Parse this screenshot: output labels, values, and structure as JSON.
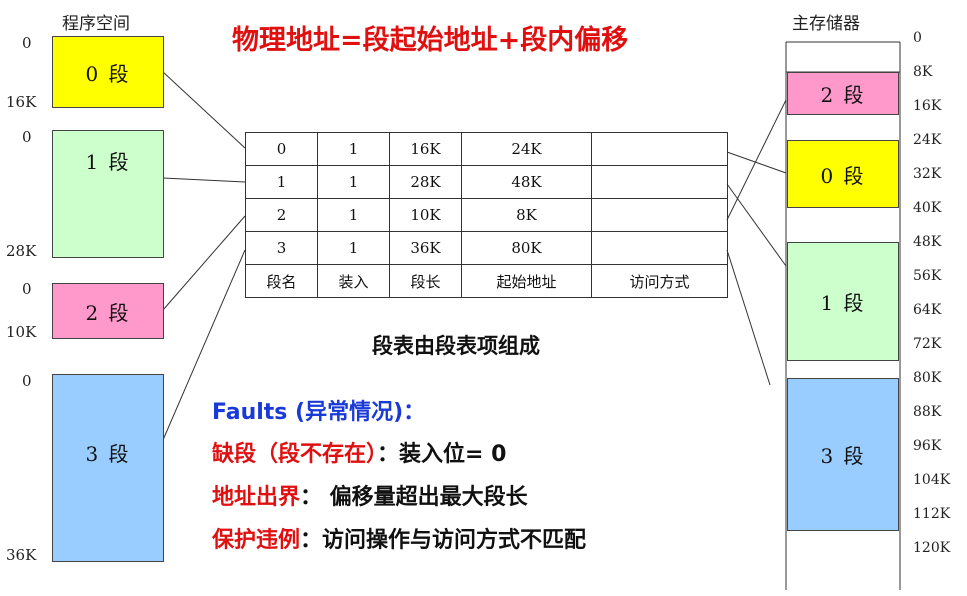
{
  "title": "物理地址=段起始地址+段内偏移",
  "program_space": {
    "label": "程序空间",
    "segments": [
      {
        "name": "0 段",
        "start": "0",
        "end": "16K",
        "color": "#ffff00"
      },
      {
        "name": "1 段",
        "start": "0",
        "end": "28K",
        "color": "#ccffcc"
      },
      {
        "name": "2 段",
        "start": "0",
        "end": "10K",
        "color": "#ff99cc"
      },
      {
        "name": "3 段",
        "start": "0",
        "end": "36K",
        "color": "#99ccff"
      }
    ]
  },
  "main_memory": {
    "label": "主存储器",
    "ticks": [
      "0",
      "8K",
      "16K",
      "24K",
      "32K",
      "40K",
      "48K",
      "56K",
      "64K",
      "72K",
      "80K",
      "88K",
      "96K",
      "104K",
      "112K",
      "120K"
    ],
    "segments": [
      {
        "name": "2 段",
        "from_k": 8,
        "to_k": 18,
        "color": "#ff99cc"
      },
      {
        "name": "0 段",
        "from_k": 24,
        "to_k": 40,
        "color": "#ffff00"
      },
      {
        "name": "1 段",
        "from_k": 48,
        "to_k": 76,
        "color": "#ccffcc"
      },
      {
        "name": "3 段",
        "from_k": 80,
        "to_k": 116,
        "color": "#99ccff"
      }
    ]
  },
  "segment_table": {
    "rows": [
      [
        "0",
        "1",
        "16K",
        "24K",
        ""
      ],
      [
        "1",
        "1",
        "28K",
        "48K",
        ""
      ],
      [
        "2",
        "1",
        "10K",
        "8K",
        ""
      ],
      [
        "3",
        "1",
        "36K",
        "80K",
        ""
      ]
    ],
    "headers": [
      "段名",
      "装入",
      "段长",
      "起始地址",
      "访问方式"
    ]
  },
  "caption": "段表由段表项组成",
  "faults": {
    "heading": "Faults (异常情况)：",
    "items": [
      {
        "key": "缺段（段不存在）",
        "value": "：装入位= 0"
      },
      {
        "key": "地址出界",
        "value": "：  偏移量超出最大段长"
      },
      {
        "key": "保护违例",
        "value": "：访问操作与访问方式不匹配"
      }
    ]
  }
}
